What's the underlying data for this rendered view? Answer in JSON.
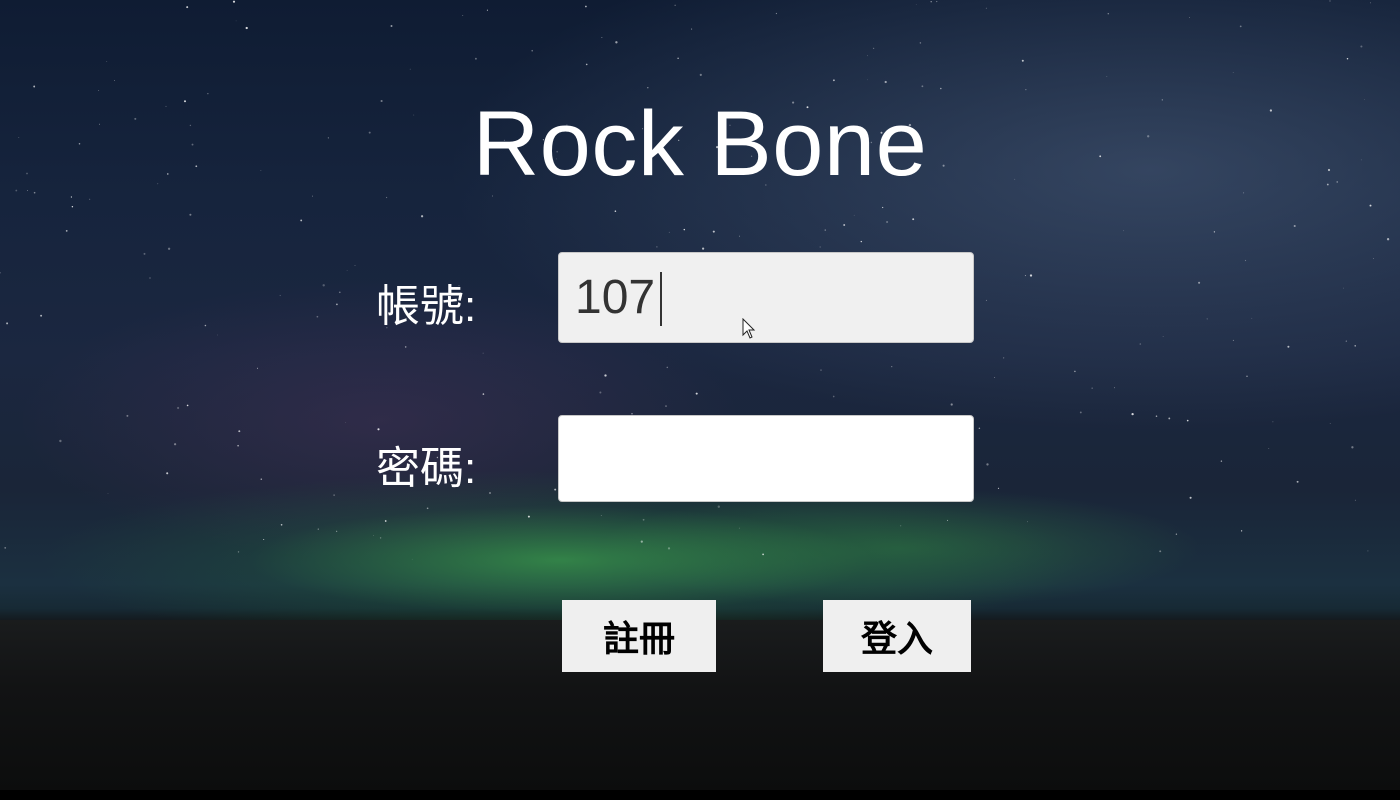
{
  "app": {
    "title": "Rock Bone"
  },
  "form": {
    "account_label": "帳號:",
    "account_value": "107",
    "password_label": "密碼:",
    "password_value": ""
  },
  "buttons": {
    "register_label": "註冊",
    "login_label": "登入"
  },
  "colors": {
    "text_on_background": "#ffffff",
    "input_active_bg": "#f0f0f0",
    "input_bg": "#ffffff",
    "button_bg": "#efefef"
  },
  "icons": {
    "mouse_pointer": "arrow-cursor-icon"
  }
}
